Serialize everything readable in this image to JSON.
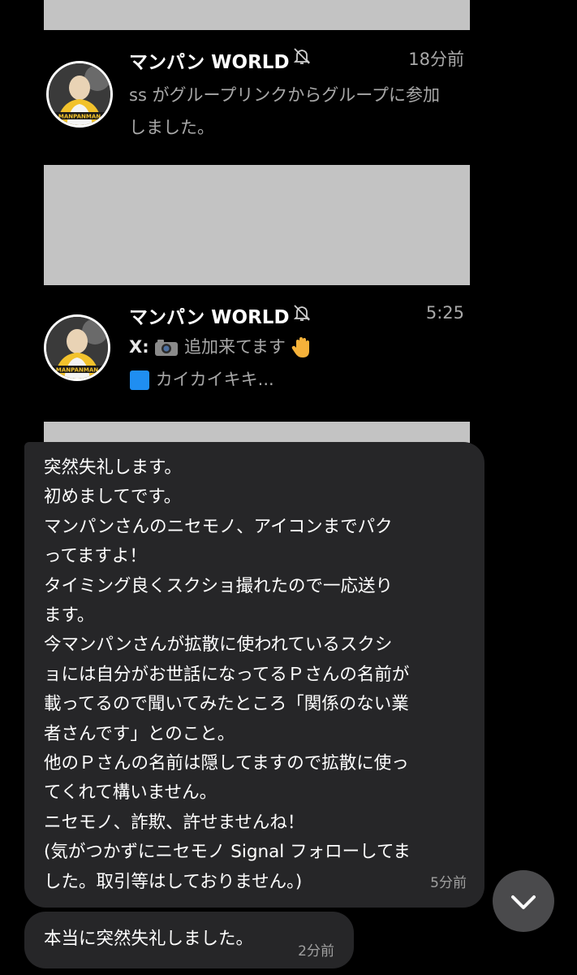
{
  "chat_list": [
    {
      "name": "マンパン WORLD",
      "time": "18分前",
      "preview_lines": [
        "ss がグループリンクからグループに参加",
        "しました。"
      ],
      "avatar_caption": "MANPANMAN"
    },
    {
      "name": "マンパン WORLD",
      "time": "5:25",
      "sender": "X:",
      "preview_text": "追加来てます",
      "preview_line2": "カイカイキキ...",
      "avatar_caption": "MANPANMAN"
    }
  ],
  "messages": [
    {
      "lines": [
        "突然失礼します。",
        "初めましてです。",
        "マンパンさんのニセモノ、アイコンまでパク",
        "ってますよ！",
        "タイミング良くスクショ撮れたので一応送り",
        "ます。",
        "今マンパンさんが拡散に使われているスクシ",
        "ョには自分がお世話になってるＰさんの名前が",
        "載ってるので聞いてみたところ「関係のない業",
        "者さんです」とのこと。",
        "他のＰさんの名前は隠してますので拡散に使っ",
        "てくれて構いません。",
        "ニセモノ、詐欺、許せませんね！",
        "(気がつかずにニセモノ Signal フォローしてま",
        "した。取引等はしておりません。)"
      ],
      "time": "5分前"
    },
    {
      "text": "本当に突然失礼しました。",
      "time": "2分前"
    }
  ],
  "colors": {
    "background": "#000000",
    "bubble": "#262628",
    "redaction": "#c3c3c3",
    "muted_text": "#a8a8a8"
  },
  "icons": [
    "bell-muted-icon",
    "camera-icon",
    "raised-hand-icon",
    "blue-square-icon",
    "chevron-down-icon"
  ]
}
